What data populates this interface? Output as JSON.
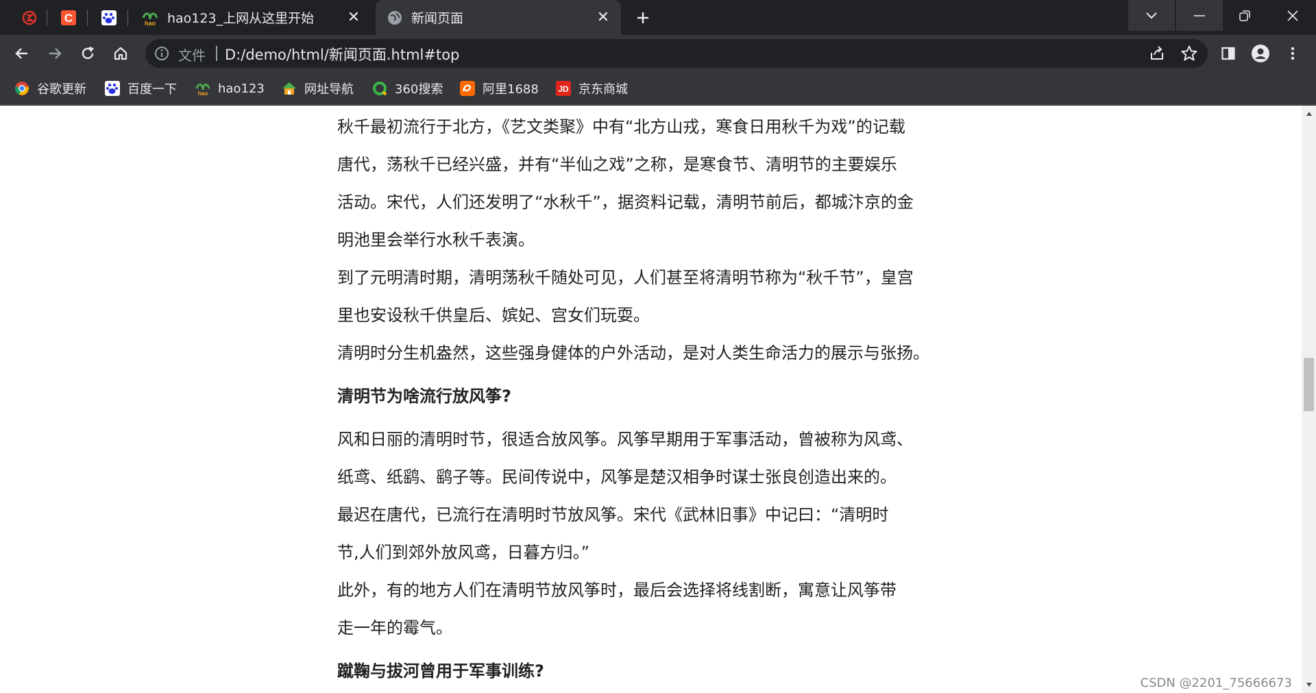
{
  "tabs": {
    "items": [
      {
        "title": "hao123_上网从这里开始",
        "favicon": "hao123-icon"
      },
      {
        "title": "新闻页面",
        "favicon": "globe-icon",
        "active": true
      }
    ],
    "pinned": [
      "csdn-red-icon",
      "c-orange-icon",
      "baidu-paw-icon"
    ],
    "close_glyph": "✕",
    "new_tab_glyph": "+"
  },
  "window_controls": [
    "tab-search-icon",
    "minimize-icon",
    "restore-icon",
    "close-icon"
  ],
  "toolbar": {
    "scheme_label": "文件",
    "url": "D:/demo/html/新闻页面.html#top"
  },
  "bookmarks": [
    {
      "label": "谷歌更新",
      "icon": "chrome-icon"
    },
    {
      "label": "百度一下",
      "icon": "baidu-paw-icon"
    },
    {
      "label": "hao123",
      "icon": "hao123-icon"
    },
    {
      "label": "网址导航",
      "icon": "house-icon"
    },
    {
      "label": "360搜索",
      "icon": "search-360-icon"
    },
    {
      "label": "阿里1688",
      "icon": "alibaba-icon"
    },
    {
      "label": "京东商城",
      "icon": "jd-icon"
    }
  ],
  "article": {
    "lines_1": [
      "秋千最初流行于北方，《艺文类聚》中有“北方山戎，寒食日用秋千为戏”的记载",
      "唐代，荡秋千已经兴盛，并有“半仙之戏”之称，是寒食节、清明节的主要娱乐",
      "活动。宋代，人们还发明了“水秋千”，据资料记载，清明节前后，都城汴京的金",
      "明池里会举行水秋千表演。",
      "到了元明清时期，清明荡秋千随处可见，人们甚至将清明节称为“秋千节”，皇宫",
      "里也安设秋千供皇后、嫔妃、宫女们玩耍。",
      "清明时分生机盎然，这些强身健体的户外活动，是对人类生命活力的展示与张扬。"
    ],
    "heading_2": "清明节为啥流行放风筝?",
    "lines_2": [
      "风和日丽的清明时节，很适合放风筝。风筝早期用于军事活动，曾被称为风鸢、",
      "纸鸢、纸鹞、鹞子等。民间传说中，风筝是楚汉相争时谋士张良创造出来的。",
      "最迟在唐代，已流行在清明时节放风筝。宋代《武林旧事》中记曰：“清明时",
      "节,人们到郊外放风鸢，日暮方归。”",
      "此外，有的地方人们在清明节放风筝时，最后会选择将线割断，寓意让风筝带",
      "走一年的霉气。"
    ],
    "heading_3": "蹴鞠与拔河曾用于军事训练?"
  },
  "watermark": "CSDN @2201_75666673",
  "scroll": {
    "position_fraction": 0.47
  },
  "colors": {
    "chrome_dark": "#202124",
    "chrome_toolbar": "#35363a",
    "text": "#e8eaed",
    "page_bg": "#ffffff"
  }
}
